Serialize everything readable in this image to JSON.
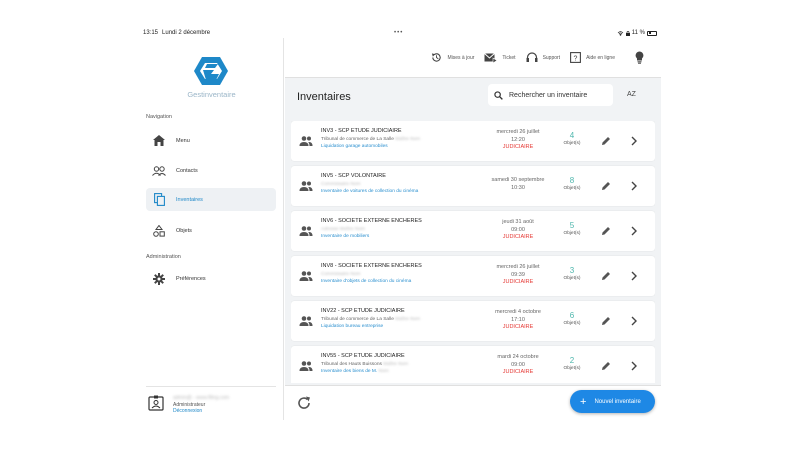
{
  "status_bar": {
    "time": "13:15",
    "date": "Lundi 2 décembre",
    "dots": "•••",
    "battery": "11 %"
  },
  "app": {
    "name": "Gestinventaire"
  },
  "sidebar": {
    "nav_section": "Navigation",
    "admin_section": "Administration",
    "items": [
      {
        "label": "Menu",
        "icon": "home-icon"
      },
      {
        "label": "Contacts",
        "icon": "contacts-icon"
      },
      {
        "label": "Inventaires",
        "icon": "copy-icon",
        "active": true
      },
      {
        "label": "Objets",
        "icon": "shapes-icon"
      },
      {
        "label": "Préférences",
        "icon": "gear-icon"
      }
    ],
    "user": {
      "email": "admin@ - www.filing.com",
      "role": "Administrateur",
      "logout": "Déconnexion"
    }
  },
  "toolbar": {
    "update": "Mises à jour",
    "ticket": "Ticket",
    "support": "Support",
    "help": "Aide en ligne"
  },
  "header": {
    "title": "Inventaires",
    "search_placeholder": "Rechercher un inventaire",
    "sort": "AZ"
  },
  "inventories": [
    {
      "ref": "INV3 - SCP ETUDE JUDICIAIRE",
      "court": "Tribunal de commerce de La Salle",
      "court_blur": "Maître Nom",
      "desc": "Liquidation garage automobiles",
      "desc_blur": "",
      "date": "mercredi 26 juillet",
      "time": "12:20",
      "type": "JUDICIAIRE",
      "count": "4",
      "obj_label": "Objet(s)"
    },
    {
      "ref": "INV5 - SCP VOLONTAIRE",
      "court": "",
      "court_blur": "Commissaire Nom",
      "desc": "Inventaire de voitures de collection du cinéma",
      "desc_blur": "",
      "date": "samedi 30 septembre",
      "time": "10:30",
      "type": "",
      "count": "8",
      "obj_label": "Objet(s)"
    },
    {
      "ref": "INV6 - SOCIETE EXTERNE ENCHERES",
      "court": "",
      "court_blur": "Adresse Maître Nom",
      "desc": "Inventaire de mobiliers",
      "desc_blur": "",
      "date": "jeudi 31 août",
      "time": "09:00",
      "type": "JUDICIAIRE",
      "count": "5",
      "obj_label": "Objet(s)"
    },
    {
      "ref": "INV8 - SOCIETE EXTERNE ENCHERES",
      "court": "",
      "court_blur": "Commissaire Nom",
      "desc": "Inventaire d'objets de collection du cinéma",
      "desc_blur": "",
      "date": "mercredi 26 juillet",
      "time": "09:39",
      "type": "JUDICIAIRE",
      "count": "3",
      "obj_label": "Objet(s)"
    },
    {
      "ref": "INV22 - SCP ETUDE JUDICIAIRE",
      "court": "Tribunal de commerce de La Salle",
      "court_blur": "Maître Nom",
      "desc": "Liquidation bureau entreprise",
      "desc_blur": "",
      "date": "mercredi 4 octobre",
      "time": "17:10",
      "type": "JUDICIAIRE",
      "count": "6",
      "obj_label": "Objet(s)"
    },
    {
      "ref": "INV55 - SCP ETUDE JUDICIAIRE",
      "court": "Tribunal des Hauts Buissons",
      "court_blur": "Maître Nom",
      "desc": "Inventaire des biens de M.",
      "desc_blur": "Nom",
      "date": "mardi 24 octobre",
      "time": "09:00",
      "type": "JUDICIAIRE",
      "count": "2",
      "obj_label": "Objet(s)"
    }
  ],
  "footer": {
    "new_button": "Nouvel inventaire",
    "plus": "+"
  },
  "colors": {
    "accent": "#1e88e5",
    "count": "#4db6ac",
    "type": "#e53935",
    "desc": "#2a8fcf"
  }
}
